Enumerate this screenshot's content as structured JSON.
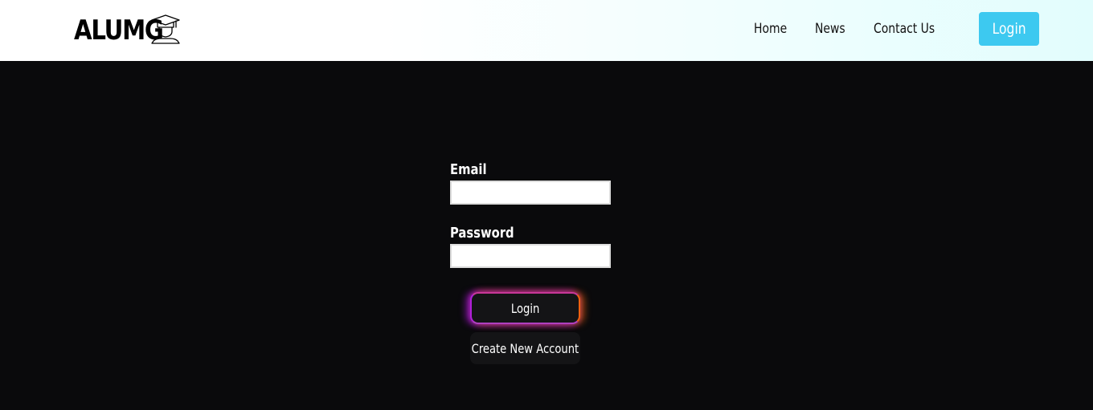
{
  "brand": {
    "name": "ALUMG",
    "icon": "graduate-icon"
  },
  "nav": {
    "home": "Home",
    "news": "News",
    "contact": "Contact Us",
    "login": "Login"
  },
  "form": {
    "email_label": "Email",
    "email_value": "",
    "password_label": "Password",
    "password_value": "",
    "login_button": "Login",
    "create_account_button": "Create New Account"
  },
  "colors": {
    "background": "#0a0a0c",
    "nav_button": "#3dc9f0",
    "glow_left": "#c81eff",
    "glow_right": "#ff6e14"
  }
}
